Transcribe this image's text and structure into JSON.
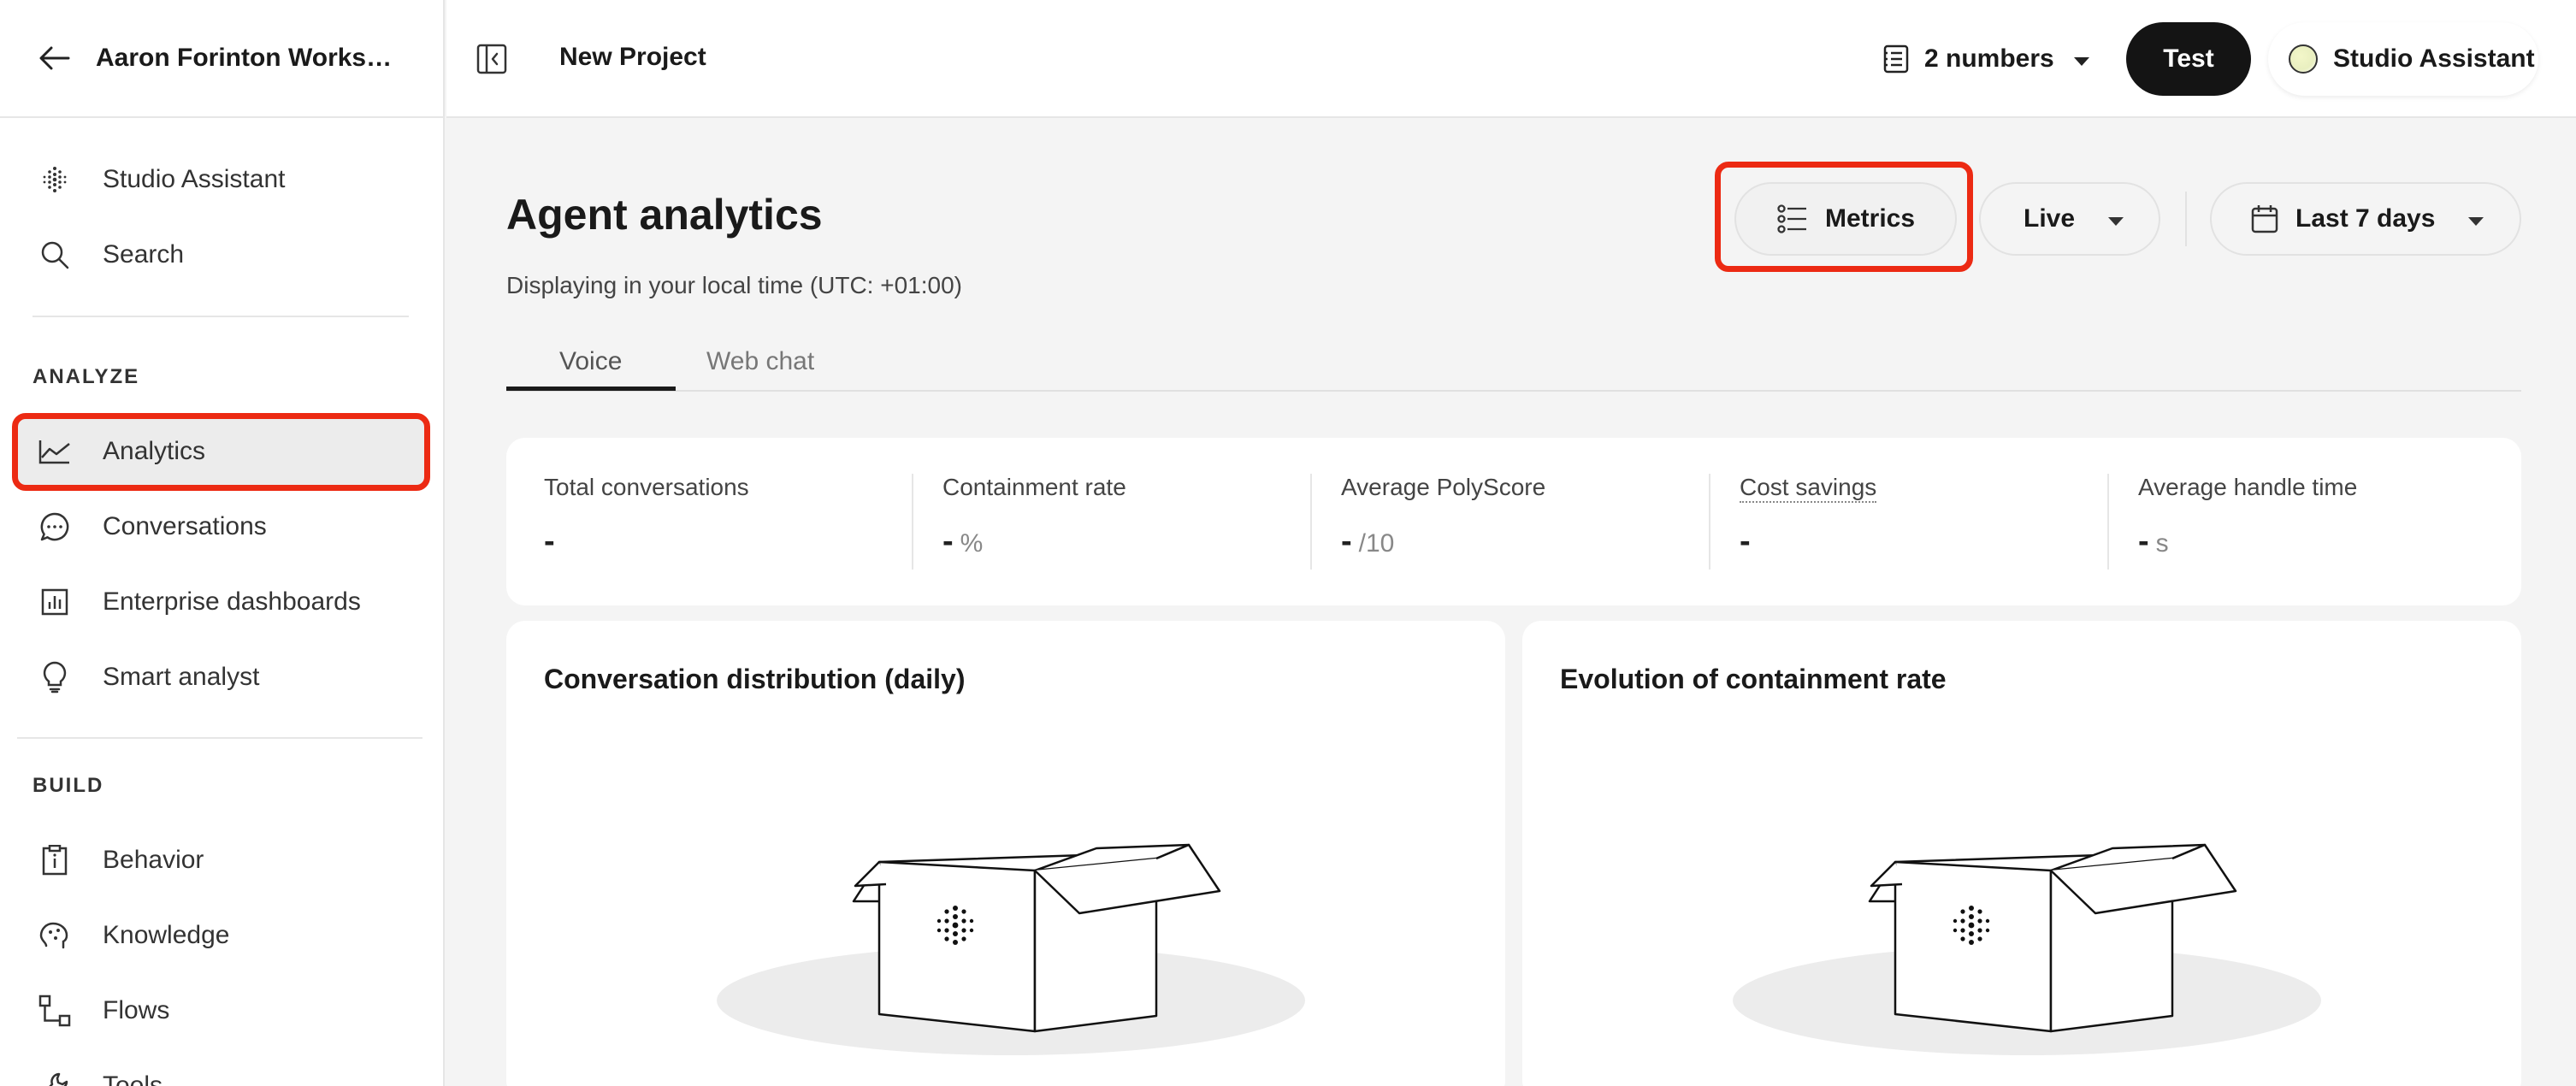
{
  "sidebar": {
    "workspace_name": "Aaron Forinton Worksp...",
    "top_items": [
      {
        "label": "Studio Assistant",
        "icon": "sparkle-dots-icon"
      },
      {
        "label": "Search",
        "icon": "search-icon"
      }
    ],
    "analyze_label": "ANALYZE",
    "analyze_items": [
      {
        "label": "Analytics",
        "icon": "line-chart-icon",
        "active": true
      },
      {
        "label": "Conversations",
        "icon": "chat-bubble-icon"
      },
      {
        "label": "Enterprise dashboards",
        "icon": "bar-chart-icon"
      },
      {
        "label": "Smart analyst",
        "icon": "lightbulb-icon"
      }
    ],
    "build_label": "BUILD",
    "build_items": [
      {
        "label": "Behavior",
        "icon": "clipboard-info-icon"
      },
      {
        "label": "Knowledge",
        "icon": "brain-icon"
      },
      {
        "label": "Flows",
        "icon": "flow-icon"
      },
      {
        "label": "Tools",
        "icon": "wrench-icon"
      }
    ]
  },
  "topbar": {
    "project_name": "New Project",
    "numbers_label": "2 numbers",
    "test_label": "Test",
    "assistant_label": "Studio Assistant"
  },
  "main": {
    "title": "Agent analytics",
    "subtitle": "Displaying in your local time (UTC: +01:00)",
    "metrics_label": "Metrics",
    "mode_label": "Live",
    "range_label": "Last 7 days",
    "tabs": [
      {
        "label": "Voice",
        "active": true
      },
      {
        "label": "Web chat",
        "active": false
      }
    ],
    "stats": [
      {
        "label": "Total conversations",
        "value": "-",
        "unit": ""
      },
      {
        "label": "Containment rate",
        "value": "-",
        "unit": "%"
      },
      {
        "label": "Average PolyScore",
        "value": "-",
        "unit": "/10"
      },
      {
        "label": "Cost savings",
        "value": "-",
        "unit": ""
      },
      {
        "label": "Average handle time",
        "value": "-",
        "unit": "s"
      }
    ],
    "charts": [
      {
        "title": "Conversation distribution (daily)"
      },
      {
        "title": "Evolution of containment rate"
      }
    ]
  },
  "colors": {
    "highlight": "#ec2a13",
    "test_button": "#141414",
    "background": "#f4f4f4"
  }
}
